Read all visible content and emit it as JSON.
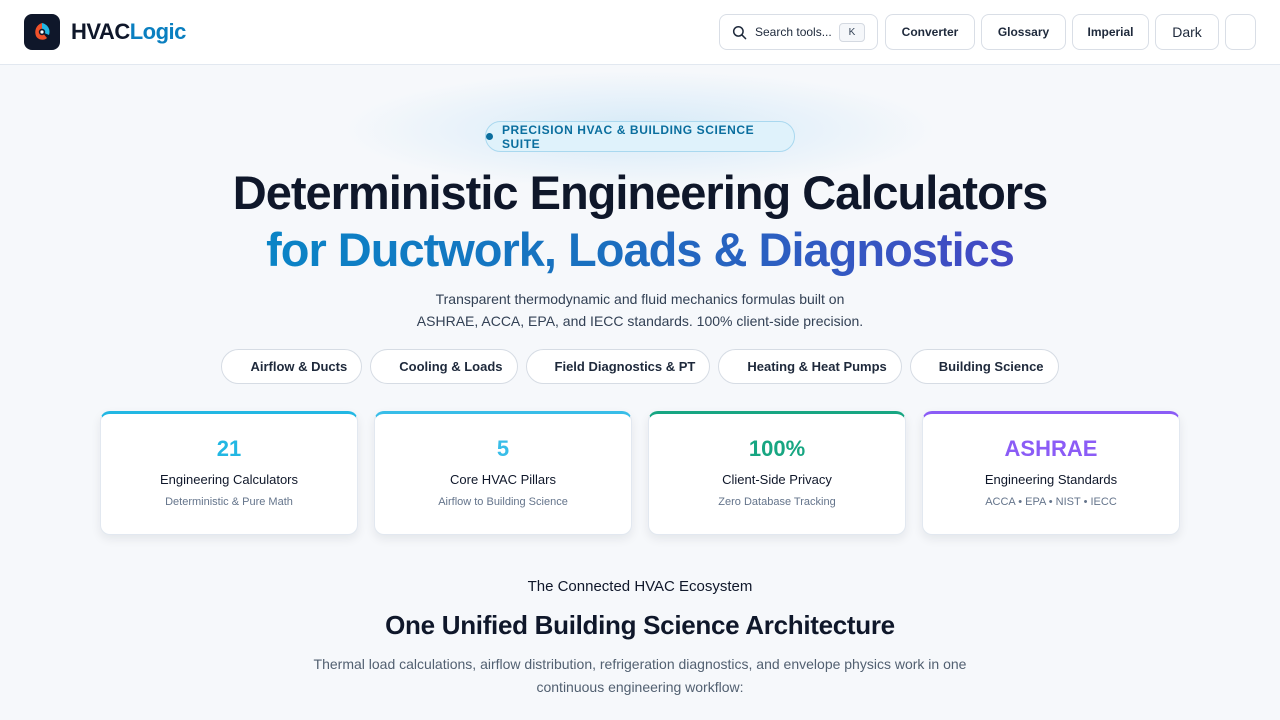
{
  "header": {
    "logo_part1": "HVAC",
    "logo_part2": "Logic",
    "search_label": "Search tools...",
    "search_shortcut": "K",
    "nav": {
      "converter": "Converter",
      "glossary": "Glossary",
      "units": "Imperial",
      "theme": "Dark"
    }
  },
  "hero": {
    "badge": "PRECISION HVAC & BUILDING SCIENCE SUITE",
    "title_line1": "Deterministic Engineering Calculators",
    "title_line2": "for Ductwork, Loads & Diagnostics",
    "subtitle_line1": "Transparent thermodynamic and fluid mechanics formulas built on",
    "subtitle_line2": "ASHRAE, ACCA, EPA, and IECC standards. 100% client-side precision.",
    "categories": [
      "Airflow & Ducts",
      "Cooling & Loads",
      "Field Diagnostics & PT",
      "Heating & Heat Pumps",
      "Building Science"
    ]
  },
  "stats": [
    {
      "value": "21",
      "label": "Engineering Calculators",
      "sub": "Deterministic & Pure Math",
      "color": "#22b7e3"
    },
    {
      "value": "5",
      "label": "Core HVAC Pillars",
      "sub": "Airflow to Building Science",
      "color": "#38bde8"
    },
    {
      "value": "100%",
      "label": "Client-Side Privacy",
      "sub": "Zero Database Tracking",
      "color": "#17a682"
    },
    {
      "value": "ASHRAE",
      "label": "Engineering Standards",
      "sub": "ACCA • EPA • NIST • IECC",
      "color": "#8b5cf6"
    }
  ],
  "ecosystem": {
    "eyebrow": "The Connected HVAC Ecosystem",
    "title": "One Unified Building Science Architecture",
    "description_line1": "Thermal load calculations, airflow distribution, refrigeration diagnostics, and envelope physics work in one",
    "description_line2": "continuous engineering workflow:"
  },
  "colors": {
    "brand": "#0a7fc0",
    "accent_gradient_start": "#0a84c6",
    "accent_gradient_end": "#4548c4"
  }
}
